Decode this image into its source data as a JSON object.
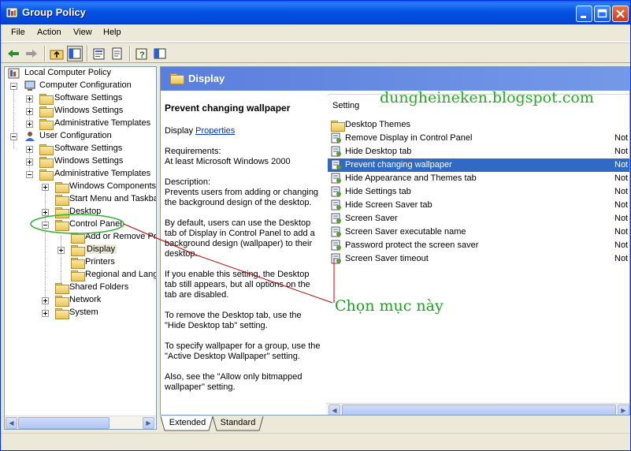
{
  "window": {
    "title": "Group Policy",
    "controls": {
      "minimize": "minimize-icon",
      "maximize": "maximize-icon",
      "close": "close-icon"
    }
  },
  "menubar": {
    "items": [
      "File",
      "Action",
      "View",
      "Help"
    ]
  },
  "toolbar": {
    "buttons": [
      "back-arrow-icon",
      "forward-arrow-icon",
      "up-folder-icon",
      "show-hide-tree-icon",
      "properties-icon",
      "export-list-icon",
      "help-icon",
      "extended-view-icon"
    ]
  },
  "tree": {
    "items": [
      {
        "label": "Local Computer Policy"
      },
      {
        "label": "Computer Configuration"
      },
      {
        "label": "Software Settings"
      },
      {
        "label": "Windows Settings"
      },
      {
        "label": "Administrative Templates"
      },
      {
        "label": "User Configuration"
      },
      {
        "label": "Software Settings"
      },
      {
        "label": "Windows Settings"
      },
      {
        "label": "Administrative Templates"
      },
      {
        "label": "Windows Components"
      },
      {
        "label": "Start Menu and Taskbar"
      },
      {
        "label": "Desktop"
      },
      {
        "label": "Control Panel"
      },
      {
        "label": "Add or Remove Programs"
      },
      {
        "label": "Display"
      },
      {
        "label": "Printers"
      },
      {
        "label": "Regional and Language Options"
      },
      {
        "label": "Shared Folders"
      },
      {
        "label": "Network"
      },
      {
        "label": "System"
      }
    ]
  },
  "right": {
    "header": "Display",
    "description": {
      "title": "Prevent changing wallpaper",
      "display_label": "Display",
      "properties_link": "Properties",
      "requirements_label": "Requirements:",
      "requirements": "At least Microsoft Windows 2000",
      "description_label": "Description:",
      "p1": "Prevents users from adding or changing the background design of the desktop.",
      "p2": "By default, users can use the Desktop tab of Display in Control Panel to add a background design (wallpaper) to their desktop.",
      "p3": "If you enable this setting, the Desktop tab still appears, but all options on the tab are disabled.",
      "p4": "To remove the Desktop tab, use the \"Hide Desktop tab\" setting.",
      "p5": "To specify wallpaper for a group, use the \"Active Desktop Wallpaper\" setting.",
      "p6": "Also, see the \"Allow only bitmapped wallpaper\" setting."
    },
    "list": {
      "column": "Setting",
      "rows": [
        {
          "label": "Desktop Themes",
          "state": "",
          "icon": "folder-icon"
        },
        {
          "label": "Remove Display in Control Panel",
          "state": "Not",
          "icon": "setting-icon"
        },
        {
          "label": "Hide Desktop tab",
          "state": "Not",
          "icon": "setting-icon"
        },
        {
          "label": "Prevent changing wallpaper",
          "state": "Not",
          "icon": "setting-icon"
        },
        {
          "label": "Hide Appearance and Themes tab",
          "state": "Not",
          "icon": "setting-icon"
        },
        {
          "label": "Hide Settings tab",
          "state": "Not",
          "icon": "setting-icon"
        },
        {
          "label": "Hide Screen Saver tab",
          "state": "Not",
          "icon": "setting-icon"
        },
        {
          "label": "Screen Saver",
          "state": "Not",
          "icon": "setting-icon"
        },
        {
          "label": "Screen Saver executable name",
          "state": "Not",
          "icon": "setting-icon"
        },
        {
          "label": "Password protect the screen saver",
          "state": "Not",
          "icon": "setting-icon"
        },
        {
          "label": "Screen Saver timeout",
          "state": "Not",
          "icon": "setting-icon"
        }
      ]
    },
    "tabs": [
      "Extended",
      "Standard"
    ]
  },
  "overlay": {
    "watermark": "dungheineken.blogspot.com",
    "annotation": "Chọn mục này"
  },
  "colors": {
    "title_bar": "#0554e3",
    "selection": "#316ac5",
    "pane_header": "#5a7edc",
    "annotation": "#17a617",
    "pointer_line": "#c00000"
  }
}
